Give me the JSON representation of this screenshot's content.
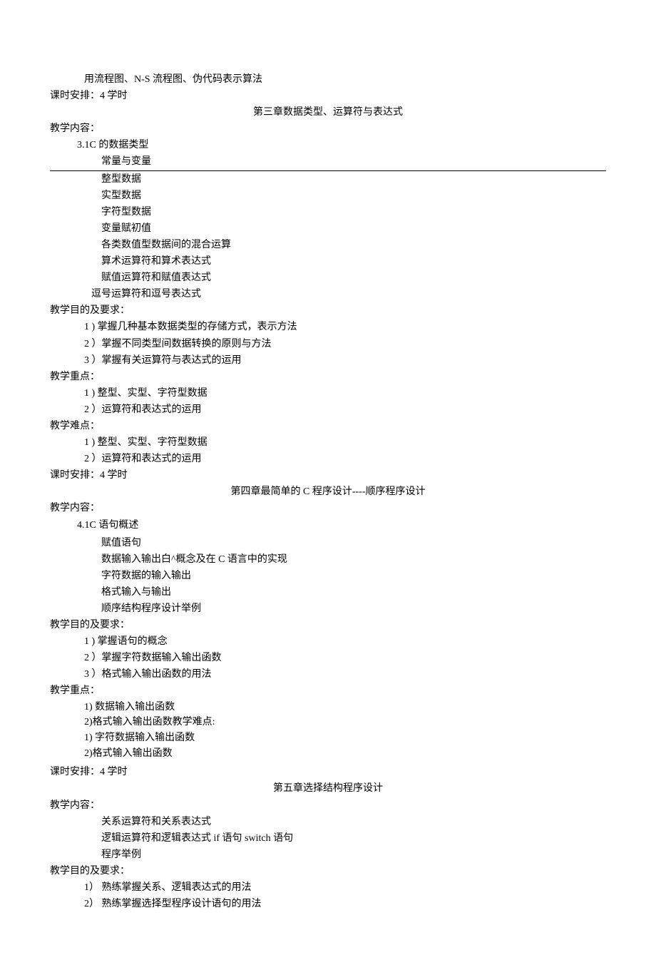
{
  "top": {
    "line1": "用流程图、N-S 流程图、伪代码表示算法",
    "schedule": "课时安排：4 学时"
  },
  "ch3": {
    "title": "第三章数据类型、运算符与表达式",
    "content_label": "教学内容：",
    "s31": "3.1C 的数据类型",
    "items": [
      "常量与变量",
      "整型数据",
      "实型数据",
      "字符型数据",
      "变量赋初值",
      "各类数值型数据间的混合运算",
      "算术运算符和算术表达式",
      "赋值运算符和赋值表达式"
    ],
    "item_last": "逗号运算符和逗号表达式",
    "obj_label": "教学目的及要求：",
    "obj1": "1 ) 掌握几种基本数据类型的存储方式，表示方法",
    "obj2": "2 ）掌握不同类型间数据转换的原则与方法",
    "obj3": "3 ）掌握有关运算符与表达式的运用",
    "focus_label": "教学重点：",
    "focus1": "1 ) 整型、实型、字符型数据",
    "focus2": "2 ）运算符和表达式的运用",
    "diff_label": "教学难点：",
    "diff1": "1 ) 整型、实型、字符型数据",
    "diff2": "2 ）运算符和表达式的运用",
    "schedule": "课时安排：4 学时"
  },
  "ch4": {
    "title": "第四章最简单的 C 程序设计----顺序程序设计",
    "content_label": "教学内容：",
    "s41": "4.1C 语句概述",
    "items": [
      "赋值语句",
      "数据输入输出白^概念及在 C 语言中的实现",
      "字符数据的输入输出",
      "格式输入与输出",
      "顺序结构程序设计举例"
    ],
    "obj_label": "教学目的及要求：",
    "obj1": "1 ) 掌握语句的概念",
    "obj2": "2 ）掌握字符数据输入输出函数",
    "obj3": "3 ）格式输入输出函数的用法",
    "focus_label": "教学重点：",
    "focus1": "1) 数据输入输出函数",
    "focus2": "2)格式输入输出函数教学难点:",
    "diff1": "1) 字符数据输入输出函数",
    "diff2": "2)格式输入输出函数",
    "schedule": "课时安排：4 学时"
  },
  "ch5": {
    "title": "第五章选择结构程序设计",
    "content_label": "教学内容：",
    "items": [
      "关系运算符和关系表达式",
      "逻辑运算符和逻辑表达式 if 语句 switch 语句",
      "程序举例"
    ],
    "obj_label": "教学目的及要求：",
    "obj1": "1） 熟练掌握关系、逻辑表达式的用法",
    "obj2": "2） 熟练掌握选择型程序设计语句的用法"
  }
}
